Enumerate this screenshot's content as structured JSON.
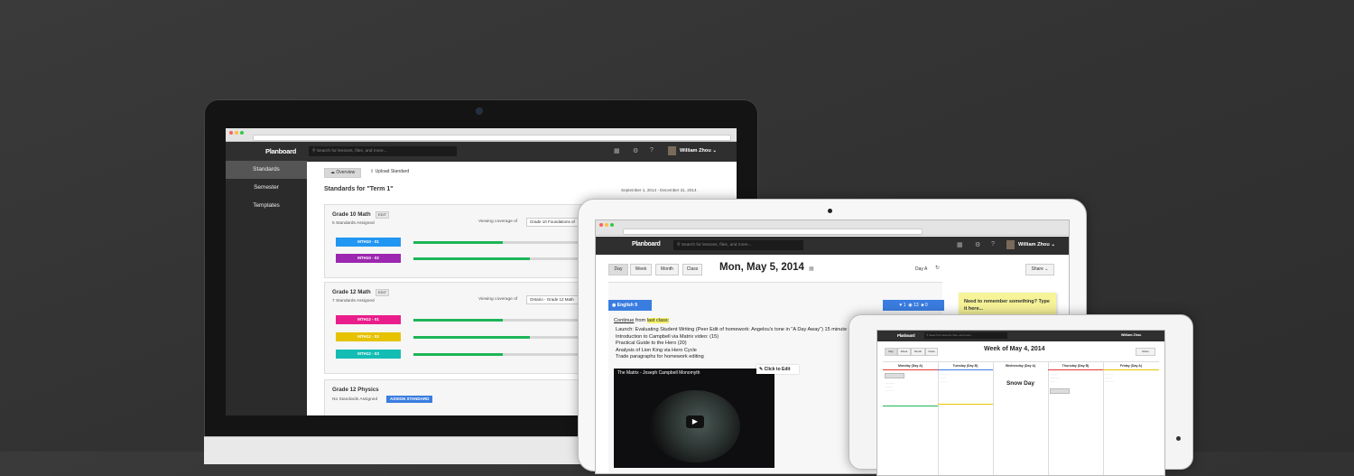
{
  "laptop": {
    "app": {
      "logo": "Planboard",
      "search_placeholder": "Search for lessons, files, and more...",
      "user": "William Zhou"
    },
    "sidebar": [
      {
        "label": "Standards",
        "active": true
      },
      {
        "label": "Semester"
      },
      {
        "label": "Templates"
      }
    ],
    "tabs": {
      "overview": "Overview",
      "upload": "Upload Standard"
    },
    "page_title": "Standards for \"Term 1\"",
    "date_range": "September 1, 2014 - December 31, 2014",
    "courses": [
      {
        "title": "Grade 10 Math",
        "edit": "EDIT",
        "assigned": "5 Standards Assigned",
        "viewing_label": "Viewing coverage of",
        "viewing_value": "Grade 10 Foundations of",
        "standards": [
          {
            "code": "MTH10 - 01",
            "color": "#2196f3",
            "fill": 0.52
          },
          {
            "code": "MTH10 - 02",
            "color": "#9c27b0",
            "fill": 0.68
          }
        ]
      },
      {
        "title": "Grade 12 Math",
        "edit": "EDIT",
        "assigned": "7 Standards Assigned",
        "viewing_label": "Viewing coverage of",
        "viewing_value": "Ontario - Grade 12 Math",
        "standards": [
          {
            "code": "MTH12 - 01",
            "color": "#e91e8c",
            "fill": 0.52
          },
          {
            "code": "MTH12 - 02",
            "color": "#e6c200",
            "fill": 0.68
          },
          {
            "code": "MTH12 - 03",
            "color": "#13bdb4",
            "fill": 0.52
          }
        ]
      },
      {
        "title": "Grade 12 Physics",
        "assigned": "No Standards Assigned",
        "assign_button": "ASSIGN STANDARD"
      }
    ]
  },
  "ipad": {
    "app": {
      "logo": "Planboard",
      "search_placeholder": "Search for lessons, files, and more...",
      "user": "William Zhou"
    },
    "views": [
      "Day",
      "Week",
      "Month",
      "Class"
    ],
    "date": "Mon, May 5, 2014",
    "day_label": "Day A",
    "share": "Share",
    "lesson": {
      "course": "English 9",
      "likes": "1",
      "views": "13",
      "comments": "0"
    },
    "continue_text": "Continue",
    "from_text": "from",
    "last_class": "last class:",
    "items": [
      "Launch: Evaluating Student Writing (Peer Edit of homework: Angelou's tone in \"A Day Away\") 15 minute",
      "Introduction to Campbell via Matrix video: (15)",
      "Practical Guide to the Hero (20)",
      "Analysis of Lion King via Hero Cycle",
      "Trade paragraphs for homework editing"
    ],
    "video_title": "The Matrix - Joseph Campbell Monomyth",
    "click_to_edit": "Click to Edit",
    "sticky_note": "Need to remember something? Type it here..."
  },
  "tablet": {
    "app": {
      "logo": "Planboard",
      "search_placeholder": "Search for lessons, files, and more...",
      "user": "William Zhou"
    },
    "week_title": "Week of May 4, 2014",
    "share": "Share",
    "days": [
      "Monday (Day A)",
      "Tuesday (Day B)",
      "Wednesday (Day A)",
      "Thursday (Day B)",
      "Friday (Day A)"
    ],
    "snow_day": "Snow Day"
  }
}
